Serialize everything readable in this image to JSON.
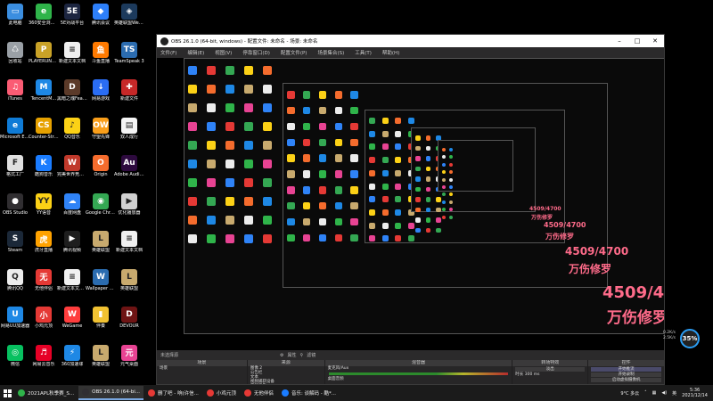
{
  "desktop_icons": [
    {
      "label": "此电脑",
      "color": "#3b8ee0",
      "glyph": "▭"
    },
    {
      "label": "360安全浏览器",
      "color": "#2fb44a",
      "glyph": "e"
    },
    {
      "label": "5E对战平台",
      "color": "#1c2540",
      "glyph": "5E"
    },
    {
      "label": "腾讯会议",
      "color": "#2d7ff9",
      "glyph": "◆"
    },
    {
      "label": "英雄联盟WeGame版",
      "color": "#1c3a5c",
      "glyph": "◈"
    },
    {
      "label": "回收站",
      "color": "#9aa0a6",
      "glyph": "♺"
    },
    {
      "label": "PLAYERUNKNOWN'S BATTLEGR...",
      "color": "#c9a227",
      "glyph": "P"
    },
    {
      "label": "新建文本文档",
      "color": "#f0f0f0",
      "glyph": "≡"
    },
    {
      "label": "斗鱼直播",
      "color": "#ff7a00",
      "glyph": "鱼"
    },
    {
      "label": "TeamSpeak 3",
      "color": "#2b6cb0",
      "glyph": "TS"
    },
    {
      "label": "iTunes",
      "color": "#fb5c74",
      "glyph": "♫"
    },
    {
      "label": "TencentM...",
      "color": "#1e88e5",
      "glyph": "M"
    },
    {
      "label": "黑暗之魂Fear sur...",
      "color": "#5b3a29",
      "glyph": "D"
    },
    {
      "label": "网易游戏",
      "color": "#2a6df4",
      "glyph": "↓"
    },
    {
      "label": "新建文件",
      "color": "#c62828",
      "glyph": "✚"
    },
    {
      "label": "Microsoft Edge",
      "color": "#0f7bd6",
      "glyph": "e"
    },
    {
      "label": "Counter-Strike Global Off...",
      "color": "#e6a100",
      "glyph": "CS"
    },
    {
      "label": "QQ音乐",
      "color": "#fcd116",
      "glyph": "♪"
    },
    {
      "label": "守望先锋",
      "color": "#f99e1a",
      "glyph": "OW"
    },
    {
      "label": "双人成行",
      "color": "#f5f5f5",
      "glyph": "▤"
    },
    {
      "label": "格式工厂",
      "color": "#e0e0e0",
      "glyph": "F"
    },
    {
      "label": "酷狗音乐",
      "color": "#1a7cff",
      "glyph": "K"
    },
    {
      "label": "完美世界竞技平台",
      "color": "#c0392b",
      "glyph": "W"
    },
    {
      "label": "Origin",
      "color": "#f56c2d",
      "glyph": "O"
    },
    {
      "label": "Adobe Audit...",
      "color": "#2d0a3e",
      "glyph": "Au"
    },
    {
      "label": "OBS Studio",
      "color": "#302e31",
      "glyph": "●"
    },
    {
      "label": "YY语音",
      "color": "#fcd116",
      "glyph": "YY"
    },
    {
      "label": "百度网盘",
      "color": "#2f83f7",
      "glyph": "☁"
    },
    {
      "label": "Google Chrome",
      "color": "#34a853",
      "glyph": "◉"
    },
    {
      "label": "优化播放器",
      "color": "#d0d0d0",
      "glyph": "▶"
    },
    {
      "label": "Steam",
      "color": "#1b2838",
      "glyph": "S"
    },
    {
      "label": "虎牙直播",
      "color": "#ffa200",
      "glyph": "虎"
    },
    {
      "label": "腾讯视频",
      "color": "#1e1e1e",
      "glyph": "▶"
    },
    {
      "label": "英雄联盟",
      "color": "#c8aa6e",
      "glyph": "L"
    },
    {
      "label": "新建文本文档",
      "color": "#f0f0f0",
      "glyph": "≡"
    },
    {
      "label": "腾讯QQ",
      "color": "#ececec",
      "glyph": "Q"
    },
    {
      "label": "无他伴侣",
      "color": "#e53935",
      "glyph": "无"
    },
    {
      "label": "新建文本文档 (2)",
      "color": "#f0f0f0",
      "glyph": "≡"
    },
    {
      "label": "Wallpaper Engine...",
      "color": "#2b6cb0",
      "glyph": "W"
    },
    {
      "label": "英雄联盟",
      "color": "#c8aa6e",
      "glyph": "L"
    },
    {
      "label": "网易UU加速器",
      "color": "#1e88e5",
      "glyph": "U"
    },
    {
      "label": "小鸡元顶",
      "color": "#e53935",
      "glyph": "小"
    },
    {
      "label": "WeGame",
      "color": "#ff3d3d",
      "glyph": "W"
    },
    {
      "label": "伴奏",
      "color": "#f1c232",
      "glyph": "▮"
    },
    {
      "label": "DEVOUR",
      "color": "#6e1414",
      "glyph": "D"
    },
    {
      "label": "微信",
      "color": "#07c160",
      "glyph": "◎"
    },
    {
      "label": "网易云音乐",
      "color": "#e60026",
      "glyph": "♬"
    },
    {
      "label": "360加速球",
      "color": "#1e88e5",
      "glyph": "⚡"
    },
    {
      "label": "英雄联盟",
      "color": "#c8aa6e",
      "glyph": "L"
    },
    {
      "label": "元气桌面",
      "color": "#e84393",
      "glyph": "元"
    }
  ],
  "obs": {
    "title": "OBS 26.1.0 (64-bit, windows) - 配置文件: 未命名 - 场景: 未命名",
    "menu": [
      "文件(F)",
      "编辑(E)",
      "视图(V)",
      "停靠窗口(D)",
      "配置文件(P)",
      "场景集合(S)",
      "工具(T)",
      "帮助(H)"
    ],
    "preview_status": "未选择源",
    "props_button": "属性",
    "filters_button": "滤镜",
    "docks": {
      "scenes": {
        "header": "场景",
        "items": [
          "场景"
        ]
      },
      "sources": {
        "header": "来源",
        "items": [
          "图像 2",
          "公告栏",
          "文本",
          "视频捕获设备",
          "音频采集",
          "显示器采集"
        ]
      },
      "mixer": {
        "header": "混音器",
        "ch1": "桌面音频",
        "ch2": "麦克风/Aux",
        "db1": "0.0 dB",
        "db2": "0.0 dB"
      },
      "transitions": {
        "header": "转场特效",
        "type": "淡出",
        "duration_label": "时长",
        "duration_value": "300 ms"
      },
      "controls": {
        "header": "控件",
        "buttons": [
          "开始推流",
          "开始录制",
          "启动虚拟摄像机",
          "工作室模式",
          "设置",
          "退出"
        ]
      }
    }
  },
  "overlay": {
    "count": "4509/4700",
    "name": "万伤修罗"
  },
  "widget": {
    "percent": "35%",
    "up": "0.2K/s",
    "down": "2.5K/s"
  },
  "taskbar": {
    "items": [
      {
        "label": "2021APL秋季赛_S...",
        "color": "#2fb44a",
        "active": false
      },
      {
        "label": "OBS 26.1.0 (64-bi...",
        "color": "#302e31",
        "active": true
      },
      {
        "label": "删了吧 - 响(许信...",
        "color": "#e53935",
        "active": false
      },
      {
        "label": "小鸡元顶",
        "color": "#e53935",
        "active": false
      },
      {
        "label": "无他伴侣",
        "color": "#e53935",
        "active": false
      },
      {
        "label": "音乐: 谈解码 - 酷*...",
        "color": "#1a7cff",
        "active": false
      }
    ],
    "weather": "9°C 多云",
    "lang": "英",
    "time": "5:36",
    "date": "2021/12/14"
  }
}
